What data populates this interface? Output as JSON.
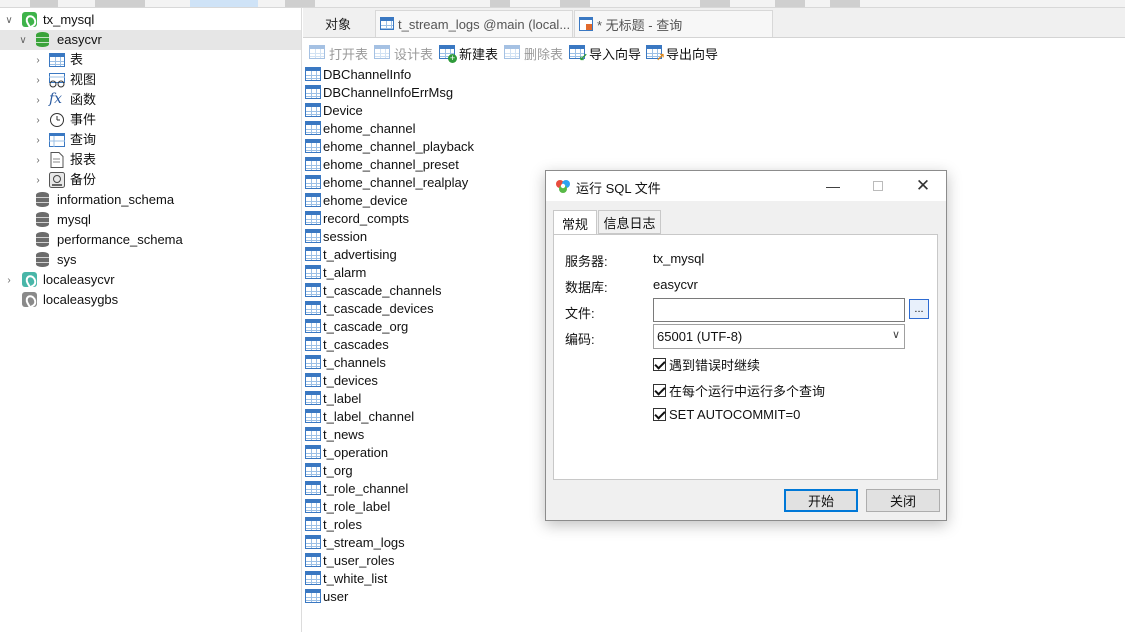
{
  "colors": {
    "accent": "#0078d7",
    "table_icon": "#3a78c2",
    "conn_green": "#3eb34a"
  },
  "sidebar": {
    "items": [
      {
        "label": "tx_mysql",
        "icon": "connection-icon",
        "expanded": true
      },
      {
        "label": "easycvr",
        "icon": "database-icon",
        "expanded": true,
        "selected": true
      },
      {
        "label": "表",
        "icon": "tables-icon"
      },
      {
        "label": "视图",
        "icon": "views-icon"
      },
      {
        "label": "函数",
        "icon": "functions-icon"
      },
      {
        "label": "事件",
        "icon": "events-icon"
      },
      {
        "label": "查询",
        "icon": "queries-icon"
      },
      {
        "label": "报表",
        "icon": "reports-icon"
      },
      {
        "label": "备份",
        "icon": "backup-icon"
      },
      {
        "label": "information_schema",
        "icon": "database-icon"
      },
      {
        "label": "mysql",
        "icon": "database-icon"
      },
      {
        "label": "performance_schema",
        "icon": "database-icon"
      },
      {
        "label": "sys",
        "icon": "database-icon"
      },
      {
        "label": "localeasycvr",
        "icon": "connection-icon"
      },
      {
        "label": "localeasygbs",
        "icon": "connection-icon"
      }
    ]
  },
  "tabs": {
    "objects": "对象",
    "tab2": "t_stream_logs @main (local...",
    "tab3": "* 无标题 - 查询"
  },
  "toolbar": {
    "open_table": "打开表",
    "design_table": "设计表",
    "new_table": "新建表",
    "delete_table": "删除表",
    "import_wizard": "导入向导",
    "export_wizard": "导出向导"
  },
  "tables": [
    "DBChannelInfo",
    "DBChannelInfoErrMsg",
    "Device",
    "ehome_channel",
    "ehome_channel_playback",
    "ehome_channel_preset",
    "ehome_channel_realplay",
    "ehome_device",
    "record_compts",
    "session",
    "t_advertising",
    "t_alarm",
    "t_cascade_channels",
    "t_cascade_devices",
    "t_cascade_org",
    "t_cascades",
    "t_channels",
    "t_devices",
    "t_label",
    "t_label_channel",
    "t_news",
    "t_operation",
    "t_org",
    "t_role_channel",
    "t_role_label",
    "t_roles",
    "t_stream_logs",
    "t_user_roles",
    "t_white_list",
    "user"
  ],
  "dialog": {
    "title": "运行 SQL 文件",
    "tab_general": "常规",
    "tab_log": "信息日志",
    "server_label": "服务器:",
    "server_value": "tx_mysql",
    "database_label": "数据库:",
    "database_value": "easycvr",
    "file_label": "文件:",
    "file_value": "",
    "browse": "...",
    "encoding_label": "编码:",
    "encoding_value": "65001 (UTF-8)",
    "opt_continue": "遇到错误时继续",
    "opt_multi": "在每个运行中运行多个查询",
    "opt_autocommit": "SET AUTOCOMMIT=0",
    "btn_start": "开始",
    "btn_close": "关闭"
  }
}
